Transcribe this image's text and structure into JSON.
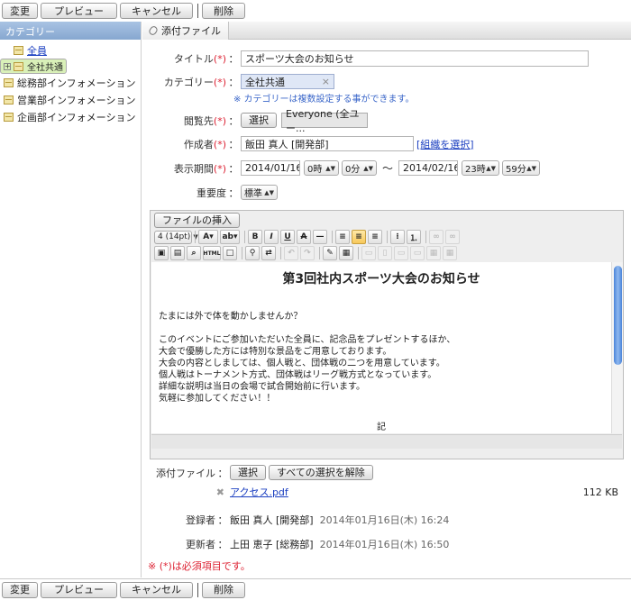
{
  "toolbar": {
    "change": "変更",
    "preview": "プレビュー",
    "cancel": "キャンセル",
    "delete": "削除"
  },
  "sidebar": {
    "title": "カテゴリー",
    "items": [
      {
        "label": "全員"
      },
      {
        "label": "全社共通"
      },
      {
        "label": "総務部インフォメーション"
      },
      {
        "label": "営業部インフォメーション"
      },
      {
        "label": "企画部インフォメーション"
      }
    ]
  },
  "tab": {
    "label": "添付ファイル"
  },
  "form": {
    "required_mark": "(*)",
    "colon": "：",
    "title_label": "タイトル",
    "title_value": "スポーツ大会のお知らせ",
    "category_label": "カテゴリー",
    "category_value": "全社共通",
    "category_note": "※ カテゴリーは複数設定する事ができます。",
    "viewer_label": "閲覧先",
    "viewer_select": "選択",
    "viewer_value": "Everyone (全ユー...",
    "author_label": "作成者",
    "author_value": "飯田 真人 [開発部]",
    "author_link": "[組織を選択]",
    "period_label": "表示期間",
    "start_date": "2014/01/16",
    "start_hour": "0時",
    "start_min": "0分",
    "tilde": "〜",
    "end_date": "2014/02/16",
    "end_hour": "23時",
    "end_min": "59分",
    "importance_label": "重要度",
    "importance_value": "標準"
  },
  "editor": {
    "insert_file": "ファイルの挿入",
    "font_size": "4 (14pt)",
    "heading": "第3回社内スポーツ大会のお知らせ",
    "line1": "たまには外で体を動かしませんか？",
    "line2": "このイベントにご参加いただいた全員に、記念品をプレゼントするほか、",
    "line3": "大会で優勝した方には特別な景品をご用意しております。",
    "line4": "大会の内容としましては、個人戦と、団体戦の二つを用意しています。",
    "line5": "個人戦はトーナメント方式、団体戦はリーグ戦方式となっています。",
    "line6": "詳細な説明は当日の会場で試合開始前に行います。",
    "line7": "気軽に参加してください！！",
    "ki": "記"
  },
  "attach": {
    "label": "添付ファイル",
    "select": "選択",
    "clear": "すべての選択を解除",
    "file_name": "アクセス.pdf",
    "file_size": "112 KB"
  },
  "meta": {
    "registrant_label": "登録者",
    "registrant_name": "飯田 真人 [開発部]",
    "registrant_time": "2014年01月16日(木) 16:24",
    "updater_label": "更新者",
    "updater_name": "上田 恵子 [総務部]",
    "updater_time": "2014年01月16日(木) 16:50"
  },
  "footnote": "※ (*)は必須項目です。"
}
